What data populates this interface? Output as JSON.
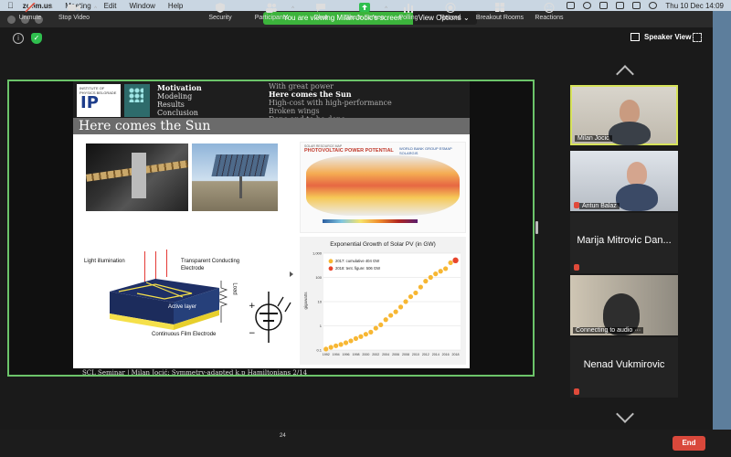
{
  "menubar": {
    "app_name": "zoom.us",
    "menus": [
      "Meeting",
      "Edit",
      "Window",
      "Help"
    ],
    "clock": "Thu 10 Dec  14:09"
  },
  "banner": {
    "message": "You are viewing Milan Jocic's screen",
    "view_options": "View Options"
  },
  "window": {
    "speaker_view": "Speaker View"
  },
  "slide": {
    "logo_text": "IP",
    "logo_small": "INSTITUTE OF PHYSICS BELGRADE",
    "nav_left": [
      "Motivation",
      "Modeling",
      "Results",
      "Conclusion"
    ],
    "nav_right": [
      "With great power",
      "Here comes the Sun",
      "High-cost with high-performance",
      "Broken wings",
      "Done and to be done"
    ],
    "active_nav": "Here comes the Sun",
    "title": "Here comes the Sun",
    "pv_subtitle": "SOLAR RESOURCE MAP",
    "pv_title": "PHOTOVOLTAIC POWER POTENTIAL",
    "pv_logos": "WORLD BANK GROUP  ESMAP  SOLARGIS",
    "cell_labels": {
      "light": "Light illumination",
      "tco": "Transparent Conducting",
      "electrode": "Electrode",
      "active": "Active layer",
      "load": "Load",
      "film": "Continuous  Film  Electrode"
    },
    "footer": "SCL Seminar   |   Milan Jocić:  Symmetry-adapted k.p Hamiltonians 2/14"
  },
  "chart_data": {
    "type": "scatter",
    "title": "Exponential Growth of Solar PV (in GW)",
    "ylabel": "gigawatts",
    "y_scale": "log",
    "ylim": [
      0.1,
      1000
    ],
    "y_ticks": [
      "1,000",
      "100",
      "10",
      "1",
      "0.1"
    ],
    "x_ticks": [
      "1992",
      "1994",
      "1996",
      "1998",
      "2000",
      "2002",
      "2004",
      "2006",
      "2008",
      "2010",
      "2012",
      "2014",
      "2016",
      "2018"
    ],
    "legend": [
      "2017: cumulative 404 GW",
      "2018: tent. figure: 506 GW"
    ],
    "legend_colors": [
      "#f7b733",
      "#e8452c"
    ],
    "series": [
      {
        "name": "2017: cumulative 404 GW",
        "x": [
          1992,
          1993,
          1994,
          1995,
          1996,
          1997,
          1998,
          1999,
          2000,
          2001,
          2002,
          2003,
          2004,
          2005,
          2006,
          2007,
          2008,
          2009,
          2010,
          2011,
          2012,
          2013,
          2014,
          2015,
          2016,
          2017
        ],
        "values": [
          0.11,
          0.13,
          0.15,
          0.17,
          0.2,
          0.24,
          0.3,
          0.36,
          0.45,
          0.55,
          0.8,
          1.1,
          1.8,
          2.7,
          3.8,
          6.0,
          10,
          16,
          23,
          40,
          70,
          100,
          140,
          180,
          230,
          404
        ]
      },
      {
        "name": "2018: tent. figure: 506 GW",
        "x": [
          2018
        ],
        "values": [
          506
        ]
      }
    ]
  },
  "participants": [
    {
      "name": "Milan Jocic",
      "type": "video"
    },
    {
      "name": "Antun Balaz",
      "type": "video"
    },
    {
      "name": "Marija Mitrovic Dan...",
      "type": "name"
    },
    {
      "name": "Connecting to audio ···",
      "type": "video"
    },
    {
      "name": "Nenad Vukmirovic",
      "type": "name"
    }
  ],
  "toolbar": {
    "unmute": "Unmute",
    "stop_video": "Stop Video",
    "security": "Security",
    "participants": "Participants",
    "participants_count": "24",
    "chat": "Chat",
    "share_screen": "Share Screen",
    "polling": "Polling",
    "record": "Record",
    "breakout": "Breakout Rooms",
    "reactions": "Reactions",
    "end": "End"
  },
  "colors": {
    "share_border": "#6cc46a",
    "active_speaker": "#d7e35a",
    "end_button": "#d9483b",
    "share_screen_icon": "#2fbf4e"
  }
}
